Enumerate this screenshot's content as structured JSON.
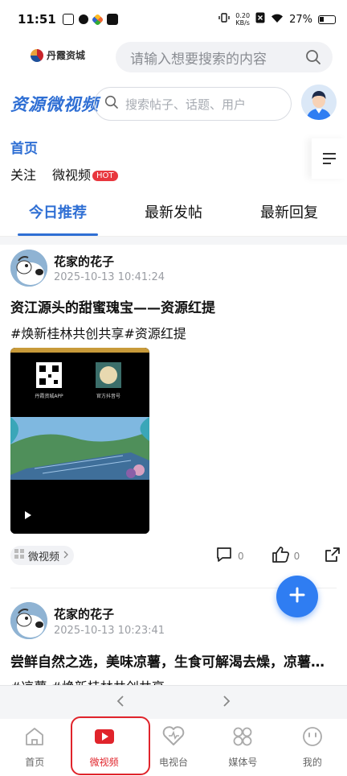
{
  "status_bar": {
    "time": "11:51",
    "net_speed_value": "0.20",
    "net_speed_unit": "KB/s",
    "battery": "27%"
  },
  "brand_bar": {
    "logo_text": "丹霞资城",
    "search_placeholder": "请输入想要搜索的内容"
  },
  "app_header": {
    "title": "资源微视频",
    "search_placeholder": "搜索帖子、话题、用户"
  },
  "channel": {
    "home": "首页",
    "subnav": [
      {
        "label": "关注"
      },
      {
        "label": "微视频",
        "badge": "HOT"
      }
    ]
  },
  "tabs": [
    {
      "label": "今日推荐",
      "active": true
    },
    {
      "label": "最新发帖",
      "active": false
    },
    {
      "label": "最新回复",
      "active": false
    }
  ],
  "posts": [
    {
      "author": "花家的花子",
      "time": "2025-10-13 10:41:24",
      "title": "资江源头的甜蜜瑰宝——资源红提",
      "tags": "#焕新桂林共创共享#资源红提",
      "video_labels": {
        "qr_left": "丹霞资城APP",
        "qr_right": "官方抖音号"
      },
      "source": "微视频",
      "comments": "0",
      "likes": "0"
    },
    {
      "author": "花家的花子",
      "time": "2025-10-13 10:23:41",
      "title": "尝鲜自然之选，美味凉薯，生食可解渴去燥，凉薯营养丰富",
      "tags": "#凉薯 #焕新桂林共创共享"
    }
  ],
  "bottom_tabs": [
    {
      "label": "首页",
      "icon": "home-icon",
      "active": false
    },
    {
      "label": "微视频",
      "icon": "video-play-icon",
      "active": true
    },
    {
      "label": "电视台",
      "icon": "tv-heart-icon",
      "active": false
    },
    {
      "label": "媒体号",
      "icon": "grid-clover-icon",
      "active": false
    },
    {
      "label": "我的",
      "icon": "smiley-icon",
      "active": false
    }
  ],
  "colors": {
    "accent_blue": "#2f6fd4",
    "active_red": "#e0242b",
    "fab_blue": "#2f7df2"
  }
}
